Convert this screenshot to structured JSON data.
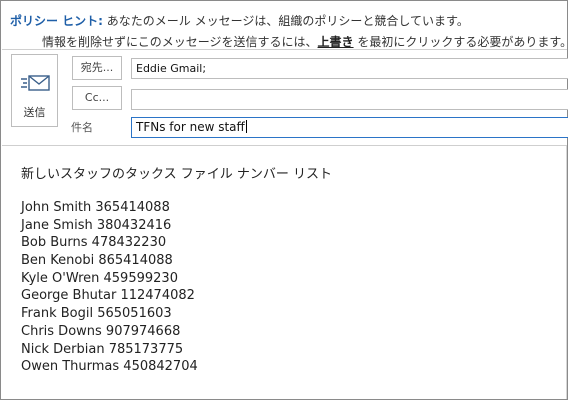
{
  "policy_tip": {
    "label": "ポリシー ヒント:",
    "line1_text": " あなたのメール メッセージは、組織のポリシーと競合しています。",
    "line2_prefix": "情報を削除せずにこのメッセージを送信するには、",
    "override_link": "上書き",
    "line2_suffix": " を最初にクリックする必要があります。"
  },
  "compose": {
    "send_label": "送信",
    "to_button": "宛先...",
    "cc_button": "Cc...",
    "subject_label": "件名",
    "to_value": "Eddie Gmail;",
    "cc_value": "",
    "subject_value": "TFNs for new staff"
  },
  "body": {
    "heading": "新しいスタッフのタックス ファイル ナンバー リスト",
    "lines": [
      "John Smith 365414088",
      "Jane Smish 380432416",
      "Bob Burns 478432230",
      "Ben Kenobi 865414088",
      "Kyle O'Wren 459599230",
      "George Bhutar 112474082",
      "Frank Bogil 565051603",
      "Chris Downs 907974668",
      "Nick Derbian 785173775",
      "Owen Thurmas 450842704"
    ]
  },
  "icons": {
    "send": "envelope-send-icon"
  },
  "colors": {
    "policy_label": "#1f5fa8",
    "focus_border": "#2b74c7"
  }
}
